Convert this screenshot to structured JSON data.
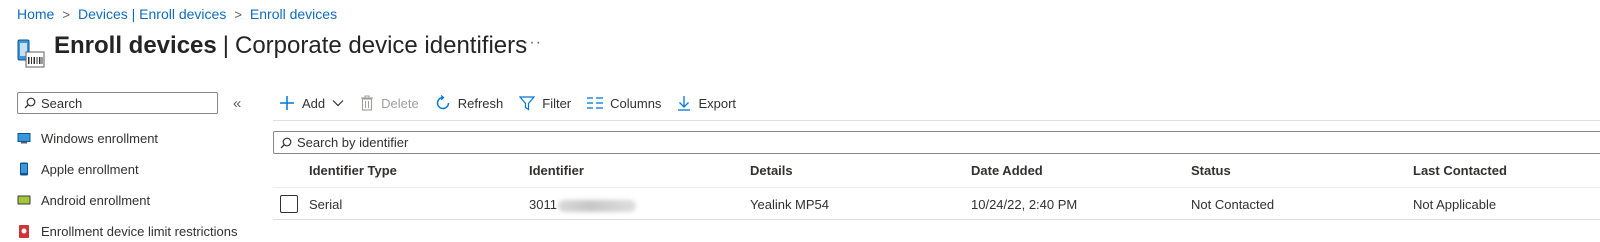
{
  "breadcrumb": [
    "Home",
    "Devices | Enroll devices",
    "Enroll devices"
  ],
  "header": {
    "title_bold": "Enroll devices",
    "title_rest": "Corporate device identifiers",
    "more": "···"
  },
  "sidebar": {
    "search_placeholder": "Search",
    "collapse": "«",
    "items": [
      {
        "label": "Windows enrollment",
        "icon": "windows-enrollment-icon"
      },
      {
        "label": "Apple enrollment",
        "icon": "apple-enrollment-icon"
      },
      {
        "label": "Android enrollment",
        "icon": "android-enrollment-icon"
      },
      {
        "label": "Enrollment device limit restrictions",
        "icon": "restriction-icon"
      }
    ]
  },
  "toolbar": {
    "add": "Add",
    "delete": "Delete",
    "refresh": "Refresh",
    "filter": "Filter",
    "columns": "Columns",
    "export": "Export"
  },
  "table": {
    "search_placeholder": "Search by identifier",
    "columns": [
      "Identifier Type",
      "Identifier",
      "Details",
      "Date Added",
      "Status",
      "Last Contacted"
    ],
    "rows": [
      {
        "identifier_type": "Serial",
        "identifier_visible": "3011",
        "details": "Yealink MP54",
        "date_added": "10/24/22, 2:40 PM",
        "status": "Not Contacted",
        "last_contacted": "Not Applicable"
      }
    ]
  },
  "colors": {
    "link": "#0f6cbd",
    "text": "#323130",
    "accent": "#0078d4"
  }
}
